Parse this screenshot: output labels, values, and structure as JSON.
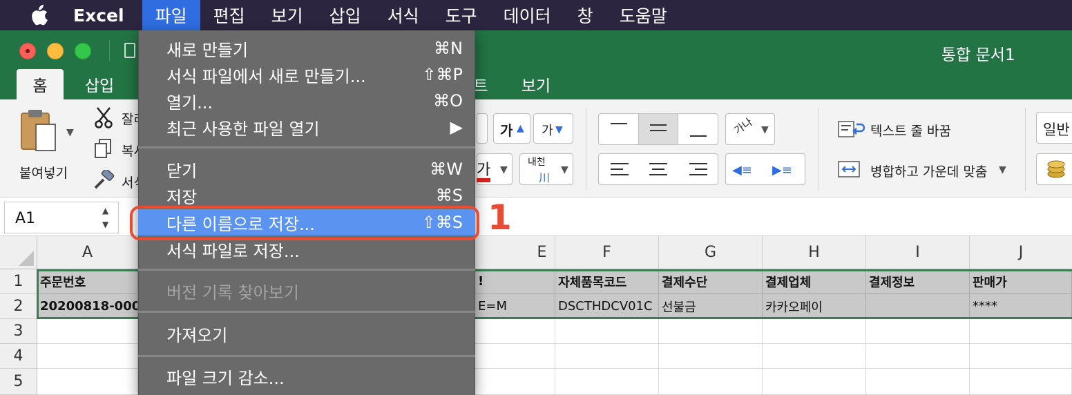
{
  "menubar": {
    "app_name": "Excel",
    "items": [
      "파일",
      "편집",
      "보기",
      "삽입",
      "서식",
      "도구",
      "데이터",
      "창",
      "도움말"
    ]
  },
  "window": {
    "title": "통합 문서1"
  },
  "ribbon_tabs": [
    "홈",
    "삽입",
    "트",
    "보기"
  ],
  "ribbon": {
    "paste": "붙여넣기",
    "cut": "잘라",
    "copy": "복사",
    "format_painter": "서식",
    "font_grow": "가",
    "font_shrink": "가",
    "text_color_char": "가",
    "phonetic_top": "내천",
    "phonetic_bottom": "川",
    "orientation": "가나",
    "wrap_text": "텍스트 줄 바꿈",
    "merge_center": "병합하고 가운데 맞춤",
    "number_format": "일반"
  },
  "namebox": {
    "value": "A1"
  },
  "columns": [
    "A",
    "E",
    "F",
    "G",
    "H",
    "I",
    "J"
  ],
  "rows": [
    "1",
    "2",
    "3",
    "4",
    "5"
  ],
  "cells": {
    "a1": "주문번호",
    "a2": "20200818-000",
    "e1": "!",
    "e2": "E=M",
    "f1": "자체품목코드",
    "f2": "DSCTHDCV01C",
    "g1": "결제수단",
    "g2": "선불금",
    "h1": "결제업체",
    "h2": "카카오페이",
    "i1": "결제정보",
    "i2": "",
    "j1": "판매가",
    "j2": "****"
  },
  "file_menu": {
    "new": {
      "label": "새로 만들기",
      "shortcut": "⌘N"
    },
    "new_from_template": {
      "label": "서식 파일에서 새로 만들기...",
      "shortcut": "⇧⌘P"
    },
    "open": {
      "label": "열기...",
      "shortcut": "⌘O"
    },
    "open_recent": {
      "label": "최근 사용한 파일 열기",
      "shortcut": "▶"
    },
    "close": {
      "label": "닫기",
      "shortcut": "⌘W"
    },
    "save": {
      "label": "저장",
      "shortcut": "⌘S"
    },
    "save_as": {
      "label": "다른 이름으로 저장...",
      "shortcut": "⇧⌘S"
    },
    "save_as_template": {
      "label": "서식 파일로 저장...",
      "shortcut": ""
    },
    "browse_versions": {
      "label": "버전 기록 찾아보기",
      "shortcut": ""
    },
    "import": {
      "label": "가져오기",
      "shortcut": ""
    },
    "reduce_size": {
      "label": "파일 크기 감소...",
      "shortcut": ""
    }
  },
  "annotation": {
    "number": "1",
    "color": "#e84c35"
  },
  "colors": {
    "excel_green": "#227445",
    "menu_highlight": "#5b93f0",
    "menubar": "#2c2540"
  }
}
